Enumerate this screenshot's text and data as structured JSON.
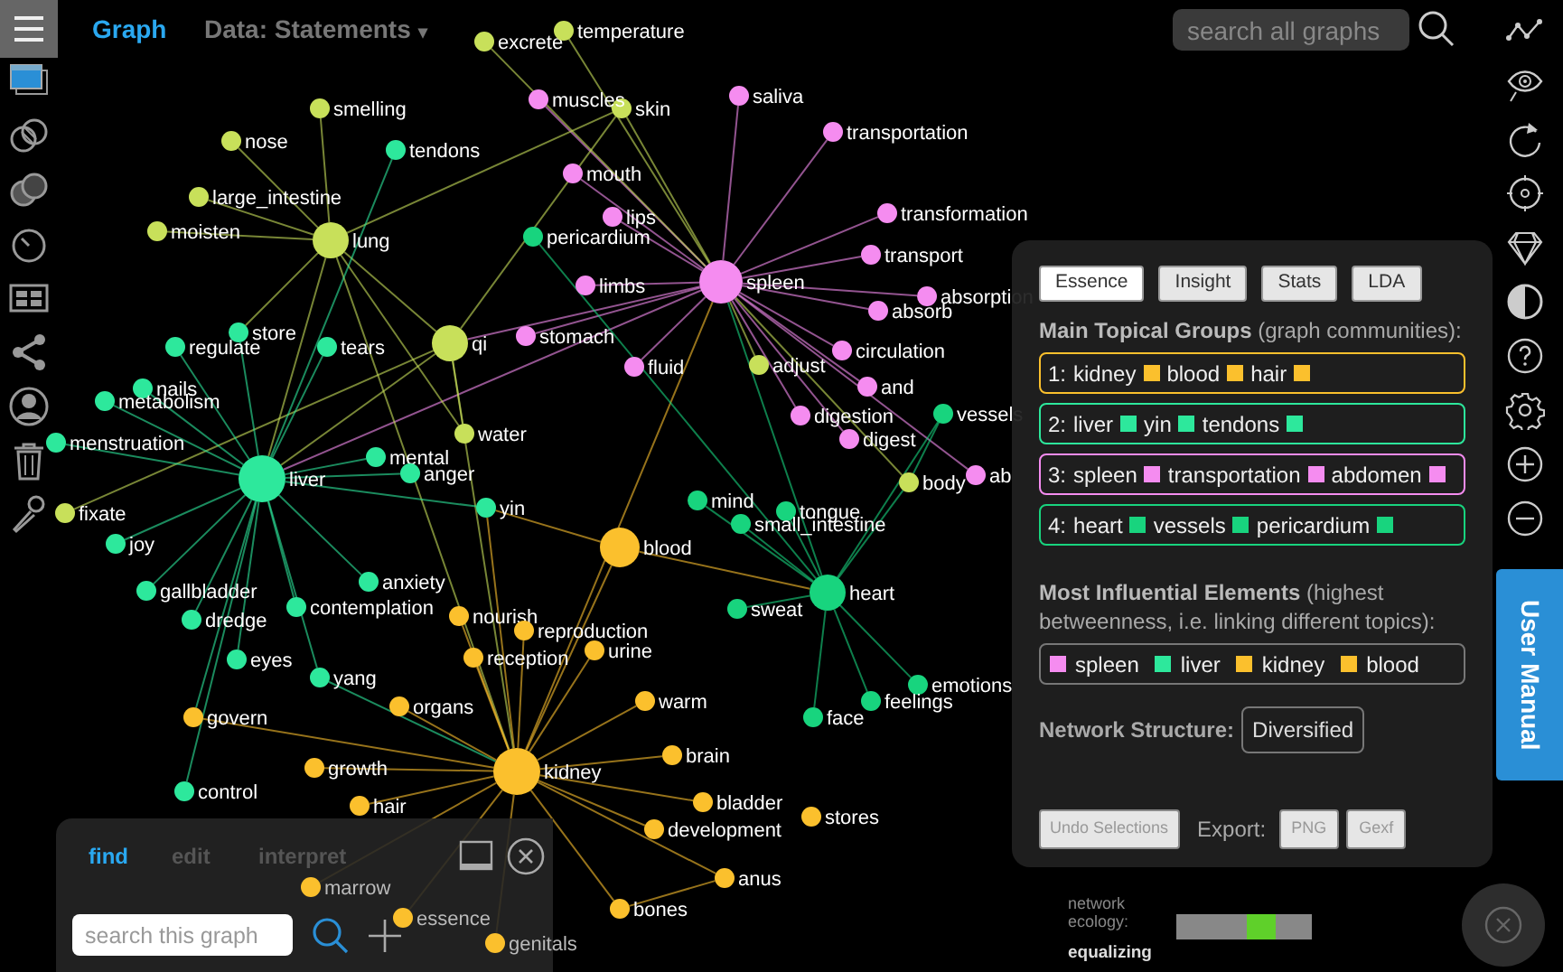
{
  "top_bar": {
    "title": "Graph",
    "data_menu": "Data: Statements",
    "caret": "▾",
    "search": {
      "placeholder": "search all graphs"
    }
  },
  "graph": {
    "nodes": [
      {
        "label": "excrete",
        "color": "#c8e05a",
        "kind": "leaf"
      },
      {
        "label": "temperature",
        "color": "#c8e05a",
        "kind": "leaf"
      },
      {
        "label": "skin",
        "color": "#c8e05a",
        "kind": "leaf"
      },
      {
        "label": "muscles",
        "color": "#f58cf0",
        "kind": "leaf"
      },
      {
        "label": "saliva",
        "color": "#f58cf0",
        "kind": "leaf"
      },
      {
        "label": "transportation",
        "color": "#f58cf0",
        "kind": "leaf"
      },
      {
        "label": "mouth",
        "color": "#f58cf0",
        "kind": "leaf"
      },
      {
        "label": "lips",
        "color": "#f58cf0",
        "kind": "leaf"
      },
      {
        "label": "pericardium",
        "color": "#18d47e",
        "kind": "leaf"
      },
      {
        "label": "transformation",
        "color": "#f58cf0",
        "kind": "leaf"
      },
      {
        "label": "transport",
        "color": "#f58cf0",
        "kind": "leaf"
      },
      {
        "label": "spleen",
        "color": "#f58cf0",
        "kind": "hub"
      },
      {
        "label": "limbs",
        "color": "#f58cf0",
        "kind": "leaf"
      },
      {
        "label": "absorption",
        "color": "#f58cf0",
        "kind": "leaf"
      },
      {
        "label": "absorb",
        "color": "#f58cf0",
        "kind": "leaf"
      },
      {
        "label": "stomach",
        "color": "#f58cf0",
        "kind": "leaf"
      },
      {
        "label": "circulation",
        "color": "#f58cf0",
        "kind": "leaf"
      },
      {
        "label": "fluid",
        "color": "#f58cf0",
        "kind": "leaf"
      },
      {
        "label": "adjust",
        "color": "#c8e05a",
        "kind": "leaf"
      },
      {
        "label": "and",
        "color": "#f58cf0",
        "kind": "leaf"
      },
      {
        "label": "digestion",
        "color": "#f58cf0",
        "kind": "leaf"
      },
      {
        "label": "vessels",
        "color": "#18d47e",
        "kind": "leaf"
      },
      {
        "label": "digest",
        "color": "#f58cf0",
        "kind": "leaf"
      },
      {
        "label": "ab",
        "color": "#f58cf0",
        "kind": "leaf"
      },
      {
        "label": "body",
        "color": "#c8e05a",
        "kind": "leaf"
      },
      {
        "label": "smelling",
        "color": "#c8e05a",
        "kind": "leaf"
      },
      {
        "label": "nose",
        "color": "#c8e05a",
        "kind": "leaf"
      },
      {
        "label": "tendons",
        "color": "#2de89c",
        "kind": "leaf"
      },
      {
        "label": "large_intestine",
        "color": "#c8e05a",
        "kind": "leaf"
      },
      {
        "label": "moisten",
        "color": "#c8e05a",
        "kind": "leaf"
      },
      {
        "label": "lung",
        "color": "#c8e05a",
        "kind": "hub"
      },
      {
        "label": "qi",
        "color": "#c8e05a",
        "kind": "hub"
      },
      {
        "label": "store",
        "color": "#2de89c",
        "kind": "leaf"
      },
      {
        "label": "regulate",
        "color": "#2de89c",
        "kind": "leaf"
      },
      {
        "label": "tears",
        "color": "#2de89c",
        "kind": "leaf"
      },
      {
        "label": "nails",
        "color": "#2de89c",
        "kind": "leaf"
      },
      {
        "label": "metabolism",
        "color": "#2de89c",
        "kind": "leaf"
      },
      {
        "label": "menstruation",
        "color": "#2de89c",
        "kind": "leaf"
      },
      {
        "label": "liver",
        "color": "#2de89c",
        "kind": "hub"
      },
      {
        "label": "mental",
        "color": "#2de89c",
        "kind": "leaf"
      },
      {
        "label": "anger",
        "color": "#2de89c",
        "kind": "leaf"
      },
      {
        "label": "water",
        "color": "#c8e05a",
        "kind": "leaf"
      },
      {
        "label": "fixate",
        "color": "#c8e05a",
        "kind": "leaf"
      },
      {
        "label": "joy",
        "color": "#2de89c",
        "kind": "leaf"
      },
      {
        "label": "yin",
        "color": "#2de89c",
        "kind": "leaf"
      },
      {
        "label": "gallbladder",
        "color": "#2de89c",
        "kind": "leaf"
      },
      {
        "label": "dredge",
        "color": "#2de89c",
        "kind": "leaf"
      },
      {
        "label": "anxiety",
        "color": "#2de89c",
        "kind": "leaf"
      },
      {
        "label": "contemplation",
        "color": "#2de89c",
        "kind": "leaf"
      },
      {
        "label": "eyes",
        "color": "#2de89c",
        "kind": "leaf"
      },
      {
        "label": "yang",
        "color": "#2de89c",
        "kind": "leaf"
      },
      {
        "label": "govern",
        "color": "#fbc02d",
        "kind": "leaf"
      },
      {
        "label": "control",
        "color": "#2de89c",
        "kind": "leaf"
      },
      {
        "label": "nourish",
        "color": "#fbc02d",
        "kind": "leaf"
      },
      {
        "label": "reproduction",
        "color": "#fbc02d",
        "kind": "leaf"
      },
      {
        "label": "reception",
        "color": "#fbc02d",
        "kind": "leaf"
      },
      {
        "label": "urine",
        "color": "#fbc02d",
        "kind": "leaf"
      },
      {
        "label": "organs",
        "color": "#fbc02d",
        "kind": "leaf"
      },
      {
        "label": "growth",
        "color": "#fbc02d",
        "kind": "leaf"
      },
      {
        "label": "hair",
        "color": "#fbc02d",
        "kind": "leaf"
      },
      {
        "label": "blood",
        "color": "#fbc02d",
        "kind": "hub"
      },
      {
        "label": "warm",
        "color": "#fbc02d",
        "kind": "leaf"
      },
      {
        "label": "kidney",
        "color": "#fbc02d",
        "kind": "hub"
      },
      {
        "label": "brain",
        "color": "#fbc02d",
        "kind": "leaf"
      },
      {
        "label": "bladder",
        "color": "#fbc02d",
        "kind": "leaf"
      },
      {
        "label": "stores",
        "color": "#fbc02d",
        "kind": "leaf"
      },
      {
        "label": "development",
        "color": "#fbc02d",
        "kind": "leaf"
      },
      {
        "label": "anus",
        "color": "#fbc02d",
        "kind": "leaf"
      },
      {
        "label": "bones",
        "color": "#fbc02d",
        "kind": "leaf"
      },
      {
        "label": "marrow",
        "color": "#fbc02d",
        "kind": "leaf"
      },
      {
        "label": "essence",
        "color": "#fbc02d",
        "kind": "leaf"
      },
      {
        "label": "genitals",
        "color": "#fbc02d",
        "kind": "leaf"
      },
      {
        "label": "mind",
        "color": "#18d47e",
        "kind": "leaf"
      },
      {
        "label": "tongue",
        "color": "#18d47e",
        "kind": "leaf"
      },
      {
        "label": "small_intestine",
        "color": "#18d47e",
        "kind": "leaf"
      },
      {
        "label": "heart",
        "color": "#18d47e",
        "kind": "hub"
      },
      {
        "label": "sweat",
        "color": "#18d47e",
        "kind": "leaf"
      },
      {
        "label": "emotions",
        "color": "#18d47e",
        "kind": "leaf"
      },
      {
        "label": "feelings",
        "color": "#18d47e",
        "kind": "leaf"
      },
      {
        "label": "face",
        "color": "#18d47e",
        "kind": "leaf"
      }
    ]
  },
  "analysis_panel": {
    "tabs": [
      {
        "label": "Essence",
        "selected": true
      },
      {
        "label": "Insight",
        "selected": false
      },
      {
        "label": "Stats",
        "selected": false
      },
      {
        "label": "LDA",
        "selected": false
      }
    ],
    "groups_heading": "**Main Topical Groups** (graph communities):",
    "groups": [
      {
        "number": "1:",
        "color": "#fbc02d",
        "items": [
          "kidney",
          "blood",
          "hair"
        ]
      },
      {
        "number": "2:",
        "color": "#2de89c",
        "items": [
          "liver",
          "yin",
          "tendons"
        ]
      },
      {
        "number": "3:",
        "color": "#f58cf0",
        "items": [
          "spleen",
          "transportation",
          "abdomen"
        ]
      },
      {
        "number": "4:",
        "color": "#18d47e",
        "items": [
          "heart",
          "vessels",
          "pericardium"
        ]
      }
    ],
    "influential_heading": "**Most Influential Elements** (highest betweenness, i.e. linking different topics):",
    "influential": [
      {
        "label": "spleen",
        "color": "#f58cf0"
      },
      {
        "label": "liver",
        "color": "#2de89c"
      },
      {
        "label": "kidney",
        "color": "#fbc02d"
      },
      {
        "label": "blood",
        "color": "#fbc02d"
      }
    ],
    "structure_label": "Network Structure:",
    "structure_value": "Diversified",
    "undo_button": {
      "label": "Undo Selections",
      "disabled": true
    },
    "export_label": "Export:",
    "export_buttons": [
      "PNG",
      "Gexf"
    ]
  },
  "user_manual": "User Manual",
  "find_panel": {
    "tabs": [
      {
        "label": "find",
        "selected": true
      },
      {
        "label": "edit",
        "selected": false
      },
      {
        "label": "interpret",
        "selected": false
      }
    ],
    "search": {
      "placeholder": "search this graph"
    }
  },
  "ecology": {
    "label": "network ecology:",
    "value": "equalizing",
    "level": 0.63
  }
}
